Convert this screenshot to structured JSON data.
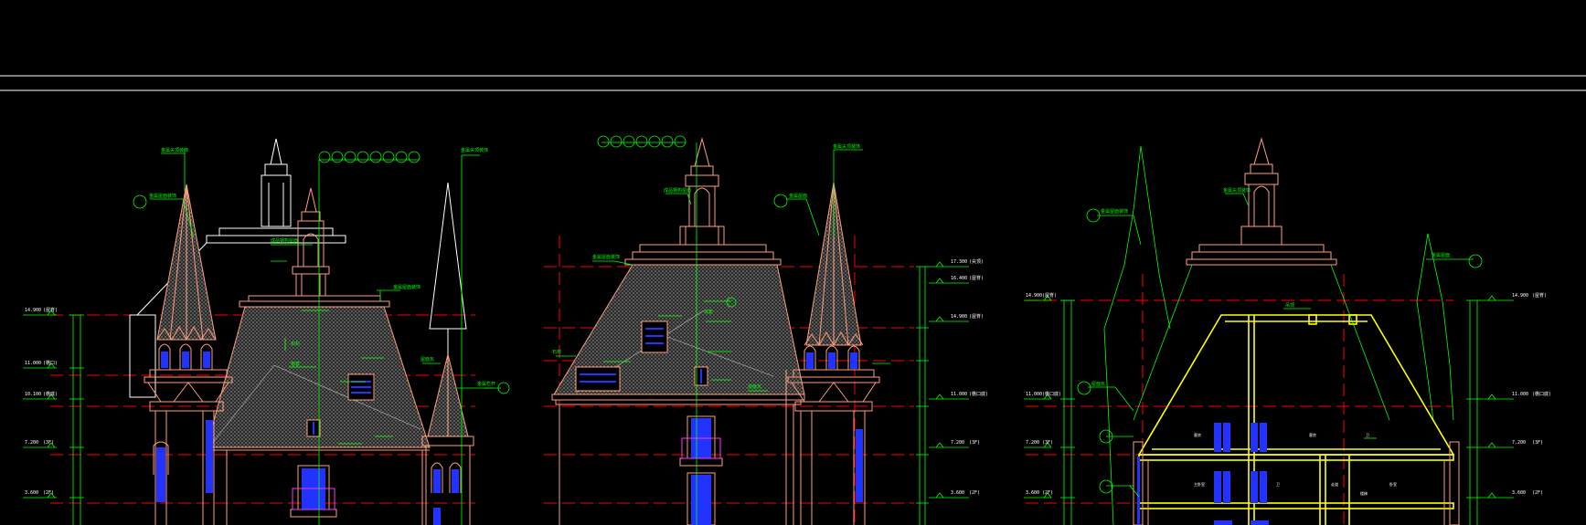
{
  "colors": {
    "background": "#000000",
    "frame": "#ffffff",
    "leader": "#00ff00",
    "datum": "#ff0000",
    "building": "#ff9d7a",
    "window": "#2233ff",
    "section": "#ffff00",
    "hatch": "#9a9a9a",
    "magenta": "#ff33ff"
  },
  "icons": [
    "section-bubble-icon",
    "level-marker-icon"
  ],
  "bubble_groups": {
    "left_top": [
      "①",
      "②",
      "③",
      "④",
      "⑤",
      "⑥",
      "⑦",
      "⑧"
    ],
    "mid_top": [
      "①",
      "②",
      "③",
      "④",
      "⑤",
      "⑥",
      "⑦"
    ]
  }
}
